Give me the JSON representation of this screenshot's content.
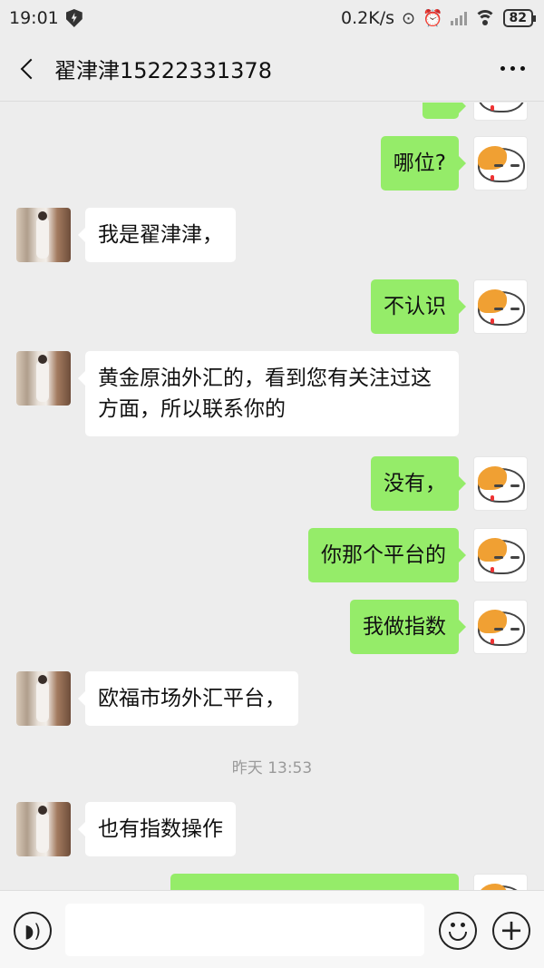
{
  "status_bar": {
    "time": "19:01",
    "net_speed": "0.2K/s",
    "link_icon": "link-icon",
    "alarm_icon": "alarm-icon",
    "battery": "82"
  },
  "header": {
    "title": "翟津津15222331378",
    "back_icon": "chevron-left-icon",
    "more_icon": "more-dots-icon"
  },
  "messages": [
    {
      "side": "right",
      "text": "哪位?"
    },
    {
      "side": "left",
      "text": "我是翟津津，"
    },
    {
      "side": "right",
      "text": "不认识"
    },
    {
      "side": "left",
      "text": "黄金原油外汇的，看到您有关注过这方面，所以联系你的"
    },
    {
      "side": "right",
      "text": "没有，"
    },
    {
      "side": "right",
      "text": "你那个平台的"
    },
    {
      "side": "right",
      "text": "我做指数"
    },
    {
      "side": "left",
      "text": "欧福市场外汇平台，"
    },
    {
      "side": "time",
      "text": "昨天 13:53"
    },
    {
      "side": "left",
      "text": "也有指数操作"
    }
  ],
  "input_bar": {
    "voice_icon": "voice-icon",
    "emoji_icon": "emoji-icon",
    "plus_icon": "plus-icon",
    "placeholder": ""
  },
  "colors": {
    "background": "#ededed",
    "sent_bubble": "#95ec69",
    "received_bubble": "#ffffff"
  }
}
